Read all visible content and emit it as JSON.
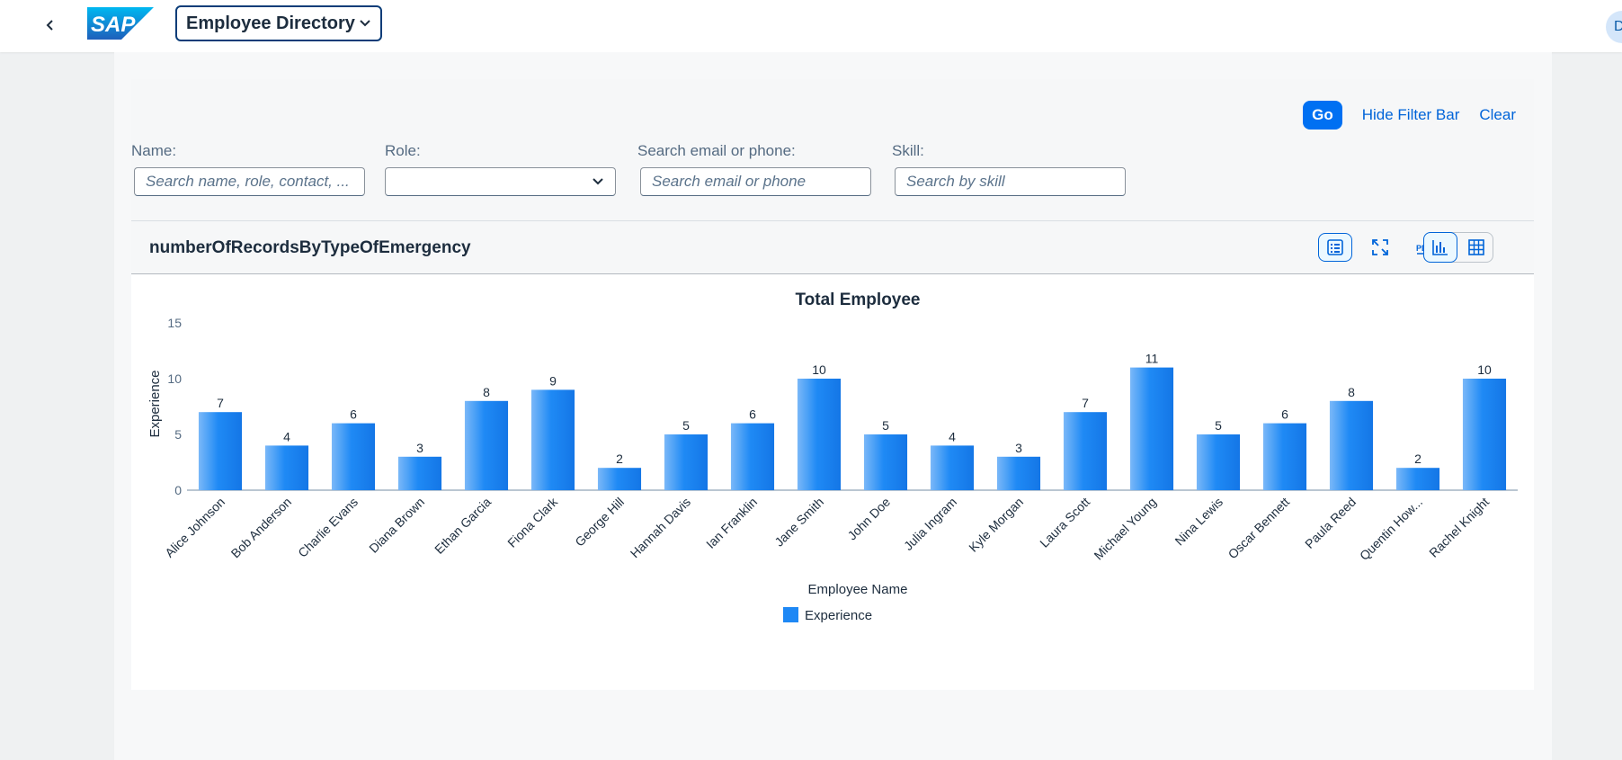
{
  "shell": {
    "app_title": "Employee Directory",
    "user_initial": "D"
  },
  "filterbar": {
    "go": "Go",
    "hide": "Hide Filter Bar",
    "clear": "Clear",
    "name_label": "Name:",
    "name_placeholder": "Search name, role, contact, ...",
    "role_label": "Role:",
    "contact_label": "Search email or phone:",
    "contact_placeholder": "Search email or phone",
    "skill_label": "Skill:",
    "skill_placeholder": "Search by skill"
  },
  "panel": {
    "title": "numberOfRecordsByTypeOfEmergency"
  },
  "colors": {
    "brand": "#0070f2",
    "bar": "#1e88f5"
  },
  "chart_data": {
    "type": "bar",
    "title": "Total Employee",
    "xlabel": "Employee Name",
    "ylabel": "Experience",
    "ylim": [
      0,
      15
    ],
    "yticks": [
      0,
      5,
      10,
      15
    ],
    "categories": [
      "Alice Johnson",
      "Bob Anderson",
      "Charlie Evans",
      "Diana Brown",
      "Ethan Garcia",
      "Fiona Clark",
      "George Hill",
      "Hannah Davis",
      "Ian Franklin",
      "Jane Smith",
      "John Doe",
      "Julia Ingram",
      "Kyle Morgan",
      "Laura Scott",
      "Michael Young",
      "Nina Lewis",
      "Oscar Bennett",
      "Paula Reed",
      "Quentin How...",
      "Rachel Knight"
    ],
    "series": [
      {
        "name": "Experience",
        "values": [
          7,
          4,
          6,
          3,
          8,
          9,
          2,
          5,
          6,
          10,
          5,
          4,
          3,
          7,
          11,
          5,
          6,
          8,
          2,
          10
        ]
      }
    ],
    "legend": "bottom-center",
    "grid": false
  }
}
